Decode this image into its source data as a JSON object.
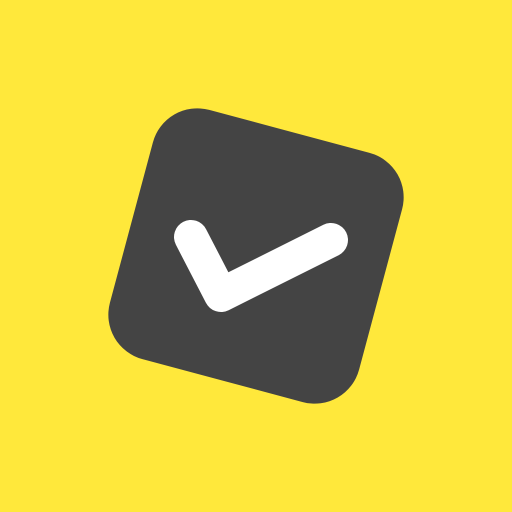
{
  "icon": {
    "name": "checkbox-checked-icon",
    "background_color": "#FFE83B",
    "tile_color": "#444444",
    "check_color": "#FFFFFF"
  }
}
